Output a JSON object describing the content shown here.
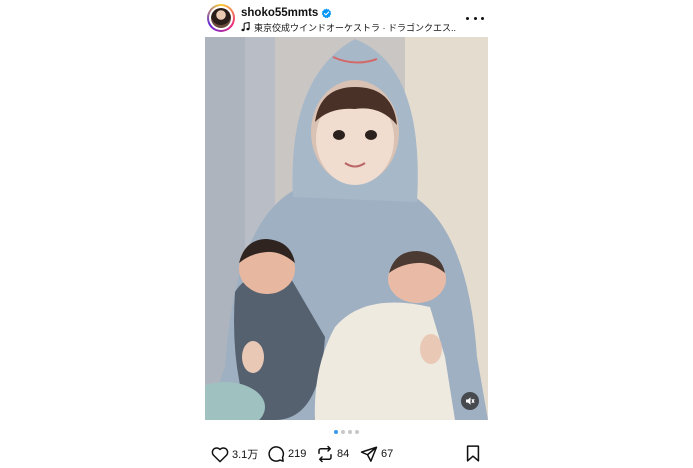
{
  "post": {
    "username": "shoko55mmts",
    "verified": true,
    "music_label": "東京佼成ウインドオーケストラ · ドラゴンクエス...",
    "carousel": {
      "count": 4,
      "active_index": 0
    },
    "stats": {
      "likes": "3.1万",
      "comments": "219",
      "reposts": "84",
      "shares": "67"
    }
  },
  "icons": {
    "verified": "verified-badge-icon",
    "music": "music-note-icon",
    "more": "more-options-icon",
    "mute": "audio-muted-icon",
    "like": "heart-icon",
    "comment": "comment-icon",
    "repost": "repost-icon",
    "share": "send-icon",
    "save": "bookmark-icon"
  },
  "colors": {
    "verified": "#0095f6",
    "active_dot": "#3897f0",
    "inactive_dot": "#c7c7c7"
  }
}
